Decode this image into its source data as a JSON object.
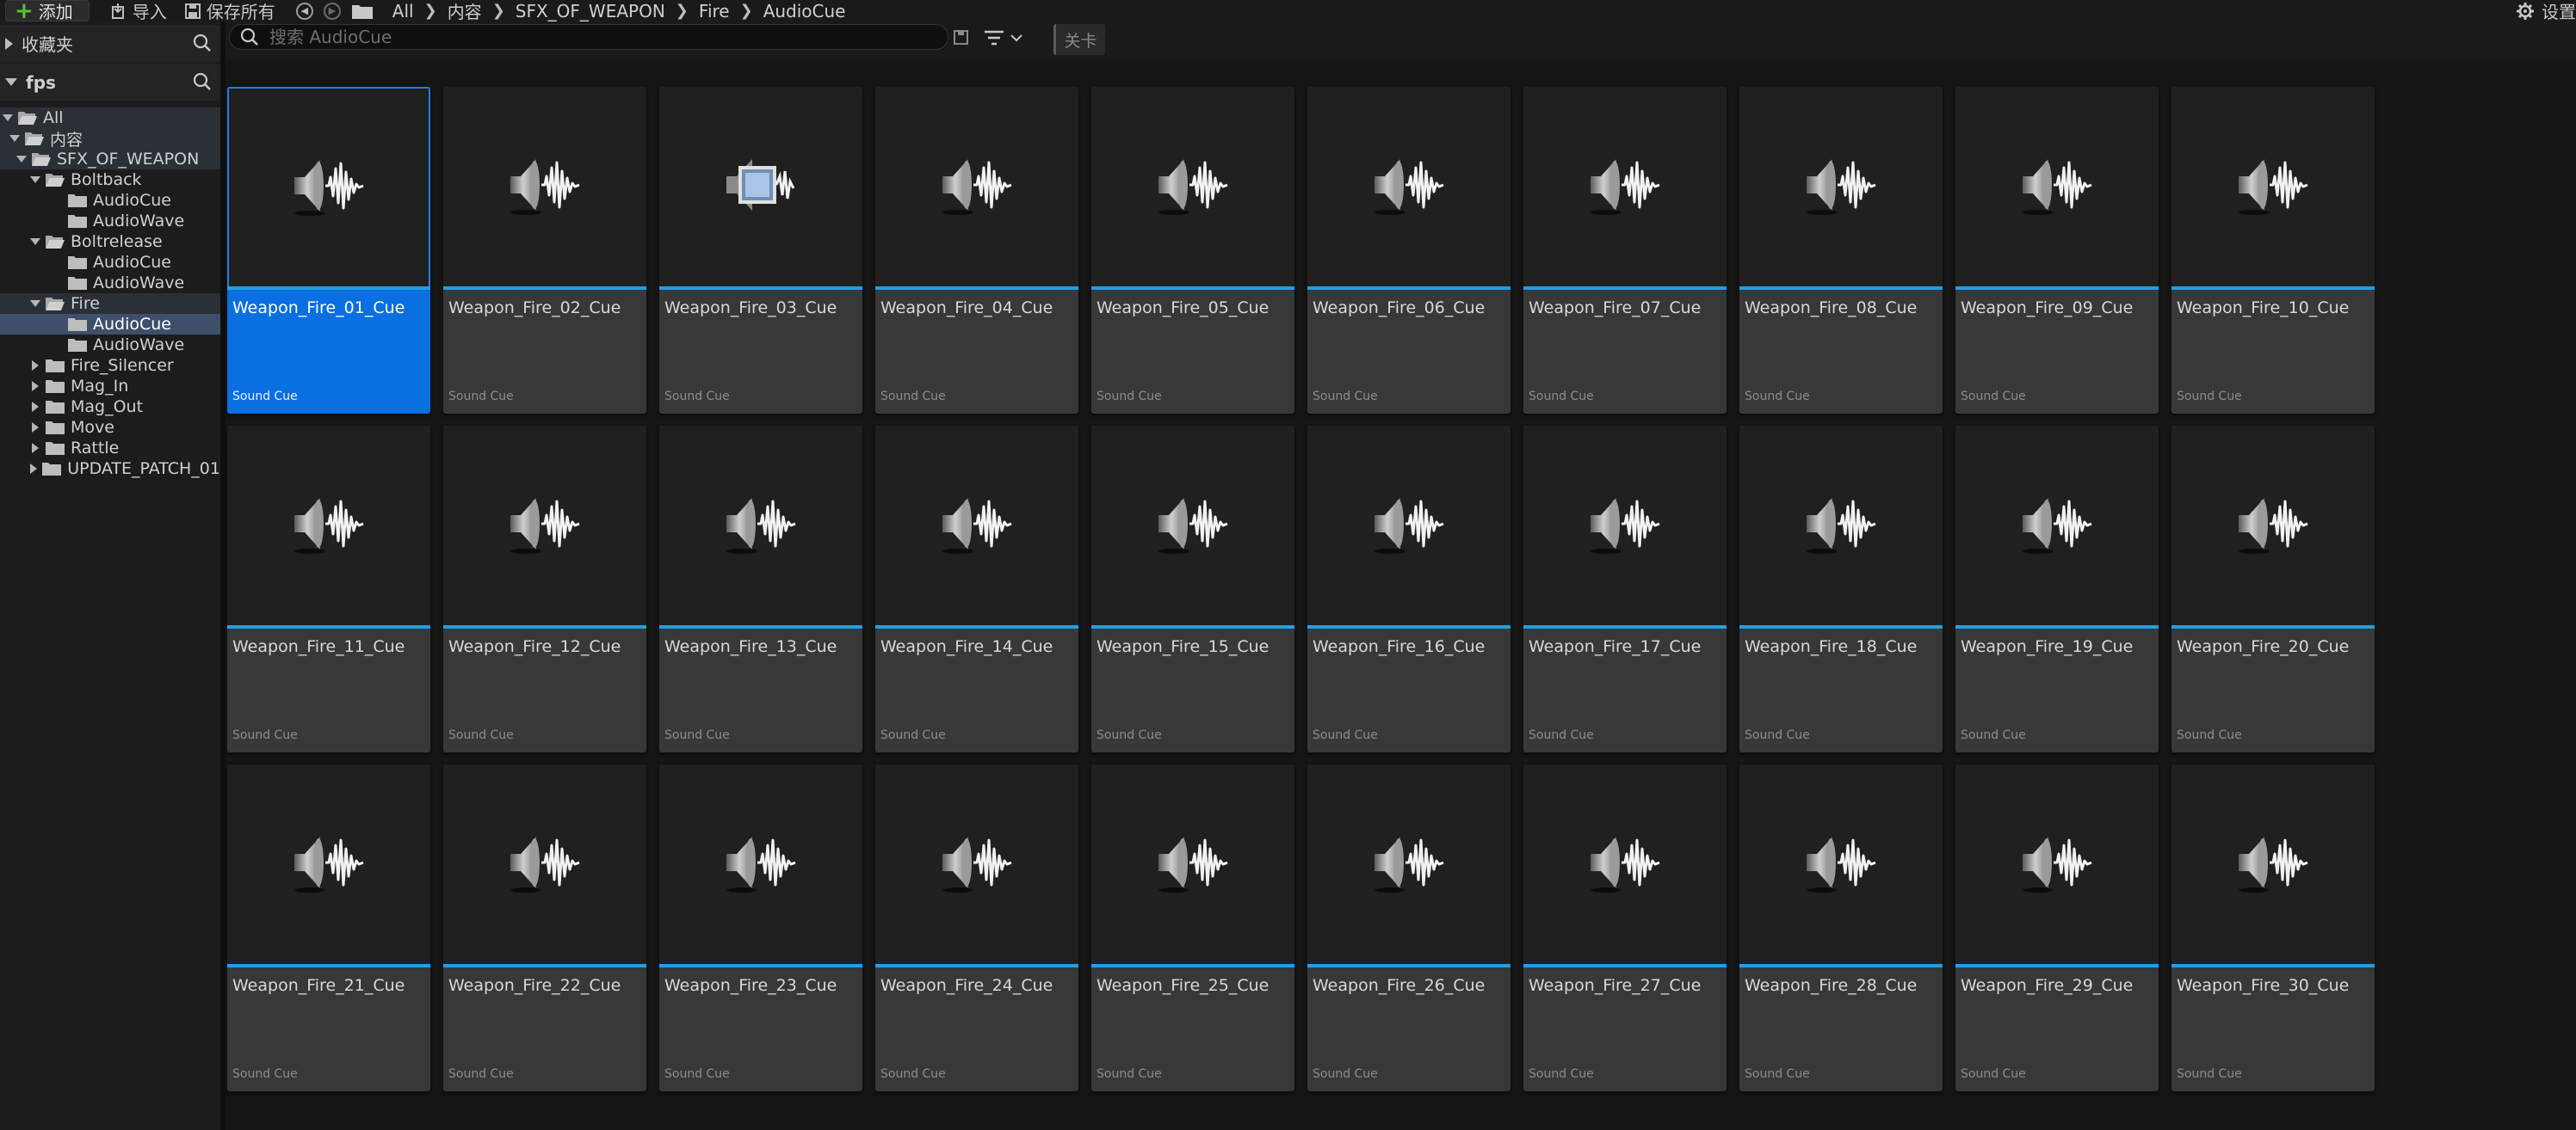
{
  "toolbar": {
    "add_label": "添加",
    "import_label": "导入",
    "save_all_label": "保存所有",
    "breadcrumbs": [
      "All",
      "内容",
      "SFX_OF_WEAPON",
      "Fire",
      "AudioCue"
    ],
    "settings_label": "设置"
  },
  "sidebar": {
    "favorites_label": "收藏夹",
    "project_label": "fps",
    "tree": [
      {
        "label": "All",
        "depth": 0,
        "expanded": true,
        "state": "parent"
      },
      {
        "label": "内容",
        "depth": 1,
        "expanded": true,
        "state": "parent"
      },
      {
        "label": "SFX_OF_WEAPON",
        "depth": 2,
        "expanded": true,
        "state": "parent"
      },
      {
        "label": "Boltback",
        "depth": 3,
        "expanded": true,
        "state": ""
      },
      {
        "label": "AudioCue",
        "depth": 4,
        "leaf": true,
        "state": ""
      },
      {
        "label": "AudioWave",
        "depth": 4,
        "leaf": true,
        "state": ""
      },
      {
        "label": "Boltrelease",
        "depth": 3,
        "expanded": true,
        "state": ""
      },
      {
        "label": "AudioCue",
        "depth": 4,
        "leaf": true,
        "state": ""
      },
      {
        "label": "AudioWave",
        "depth": 4,
        "leaf": true,
        "state": ""
      },
      {
        "label": "Fire",
        "depth": 3,
        "expanded": true,
        "state": "parent"
      },
      {
        "label": "AudioCue",
        "depth": 4,
        "leaf": true,
        "state": "selected"
      },
      {
        "label": "AudioWave",
        "depth": 4,
        "leaf": true,
        "state": ""
      },
      {
        "label": "Fire_Silencer",
        "depth": 3,
        "expanded": false,
        "state": ""
      },
      {
        "label": "Mag_In",
        "depth": 3,
        "expanded": false,
        "state": ""
      },
      {
        "label": "Mag_Out",
        "depth": 3,
        "expanded": false,
        "state": ""
      },
      {
        "label": "Move",
        "depth": 3,
        "expanded": false,
        "state": ""
      },
      {
        "label": "Rattle",
        "depth": 3,
        "expanded": false,
        "state": ""
      },
      {
        "label": "UPDATE_PATCH_01",
        "depth": 3,
        "expanded": false,
        "state": ""
      }
    ]
  },
  "filter_bar": {
    "search_placeholder": "搜索 AudioCue",
    "filter_chip_label": "关卡"
  },
  "assets": {
    "selected_index": 0,
    "special_icon_index": 2,
    "type_label": "Sound Cue",
    "items": [
      "Weapon_Fire_01_Cue",
      "Weapon_Fire_02_Cue",
      "Weapon_Fire_03_Cue",
      "Weapon_Fire_04_Cue",
      "Weapon_Fire_05_Cue",
      "Weapon_Fire_06_Cue",
      "Weapon_Fire_07_Cue",
      "Weapon_Fire_08_Cue",
      "Weapon_Fire_09_Cue",
      "Weapon_Fire_10_Cue",
      "Weapon_Fire_11_Cue",
      "Weapon_Fire_12_Cue",
      "Weapon_Fire_13_Cue",
      "Weapon_Fire_14_Cue",
      "Weapon_Fire_15_Cue",
      "Weapon_Fire_16_Cue",
      "Weapon_Fire_17_Cue",
      "Weapon_Fire_18_Cue",
      "Weapon_Fire_19_Cue",
      "Weapon_Fire_20_Cue",
      "Weapon_Fire_21_Cue",
      "Weapon_Fire_22_Cue",
      "Weapon_Fire_23_Cue",
      "Weapon_Fire_24_Cue",
      "Weapon_Fire_25_Cue",
      "Weapon_Fire_26_Cue",
      "Weapon_Fire_27_Cue",
      "Weapon_Fire_28_Cue",
      "Weapon_Fire_29_Cue",
      "Weapon_Fire_30_Cue"
    ]
  },
  "colors": {
    "accent": "#1fa0e6",
    "selection": "#0a6fe0",
    "add_plus": "#5bc236"
  }
}
